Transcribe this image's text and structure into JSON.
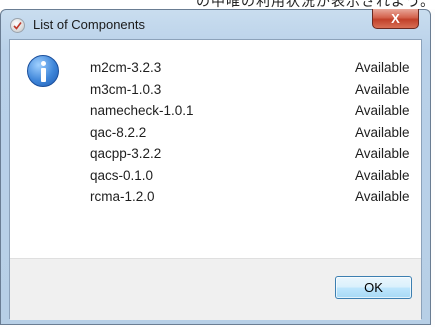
{
  "background_text": "の中唯の利用状況が表示されよう。",
  "window": {
    "title": "List of Components",
    "close_label": "X"
  },
  "icons": {
    "title_icon": "check-icon",
    "message_icon": "info-icon"
  },
  "components": [
    {
      "name": "m2cm-3.2.3",
      "status": "Available"
    },
    {
      "name": "m3cm-1.0.3",
      "status": "Available"
    },
    {
      "name": "namecheck-1.0.1",
      "status": "Available"
    },
    {
      "name": "qac-8.2.2",
      "status": "Available"
    },
    {
      "name": "qacpp-3.2.2",
      "status": "Available"
    },
    {
      "name": "qacs-0.1.0",
      "status": "Available"
    },
    {
      "name": "rcma-1.2.0",
      "status": "Available"
    }
  ],
  "buttons": {
    "ok_label": "OK"
  }
}
